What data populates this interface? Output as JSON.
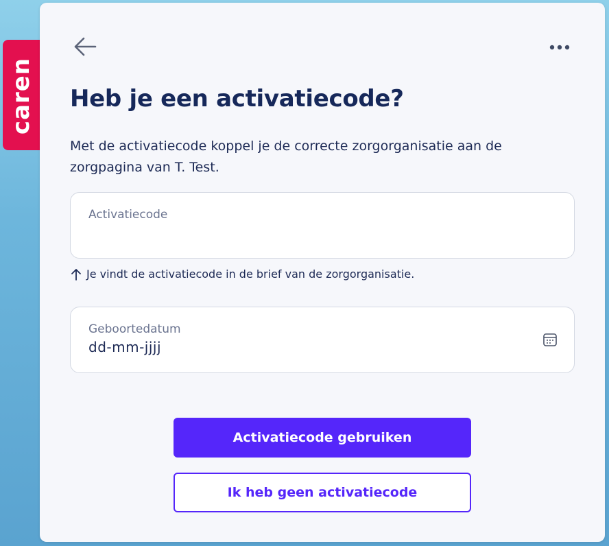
{
  "brand": {
    "name": "caren",
    "color": "#e3104f"
  },
  "header": {
    "back_icon": "arrow-left-icon",
    "more_icon": "ellipsis-icon"
  },
  "page": {
    "title": "Heb je een activatiecode?",
    "description": "Met de activatiecode koppel je de correcte zorgorganisatie aan de zorgpagina van T. Test."
  },
  "form": {
    "activation_code": {
      "label": "Activatiecode",
      "value": ""
    },
    "hint": {
      "icon": "arrow-up-icon",
      "text": "Je vindt de activatiecode in de brief van de zorgorganisatie."
    },
    "birthdate": {
      "label": "Geboortedatum",
      "value": "dd-mm-jjjj",
      "icon": "calendar-icon"
    }
  },
  "actions": {
    "primary_label": "Activatiecode gebruiken",
    "secondary_label": "Ik heb geen activatiecode"
  },
  "colors": {
    "accent": "#5526fa",
    "title": "#16285a",
    "background": "#f6f7fb"
  }
}
